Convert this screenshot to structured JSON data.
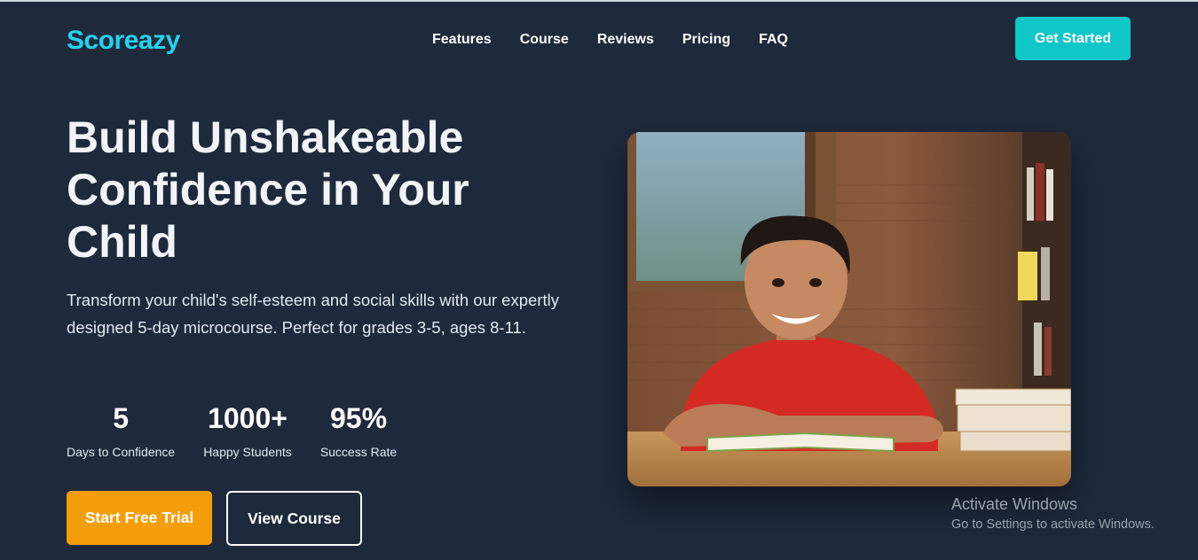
{
  "brand": {
    "name": "Scoreazy"
  },
  "nav": {
    "items": [
      "Features",
      "Course",
      "Reviews",
      "Pricing",
      "FAQ"
    ],
    "cta_label": "Get Started"
  },
  "hero": {
    "title_lines": [
      "Build Unshakeable",
      "Confidence in Your",
      "Child"
    ],
    "subtitle": "Transform your child's self-esteem and social skills with our expertly designed 5-day microcourse. Perfect for grades 3-5, ages 8-11.",
    "stats": [
      {
        "value": "5",
        "label": "Days to Confidence"
      },
      {
        "value": "1000+",
        "label": "Happy Students"
      },
      {
        "value": "95%",
        "label": "Success Rate"
      }
    ],
    "primary_button": "Start Free Trial",
    "secondary_button": "View Course",
    "image_icon": "photo-boy-reading-at-desk"
  },
  "watermark": {
    "title": "Activate Windows",
    "subtitle": "Go to Settings to activate Windows."
  },
  "colors": {
    "background": "#1e293b",
    "brand": "#22d3ee",
    "cta": "#0fc6c8",
    "primary": "#f59e0b"
  }
}
